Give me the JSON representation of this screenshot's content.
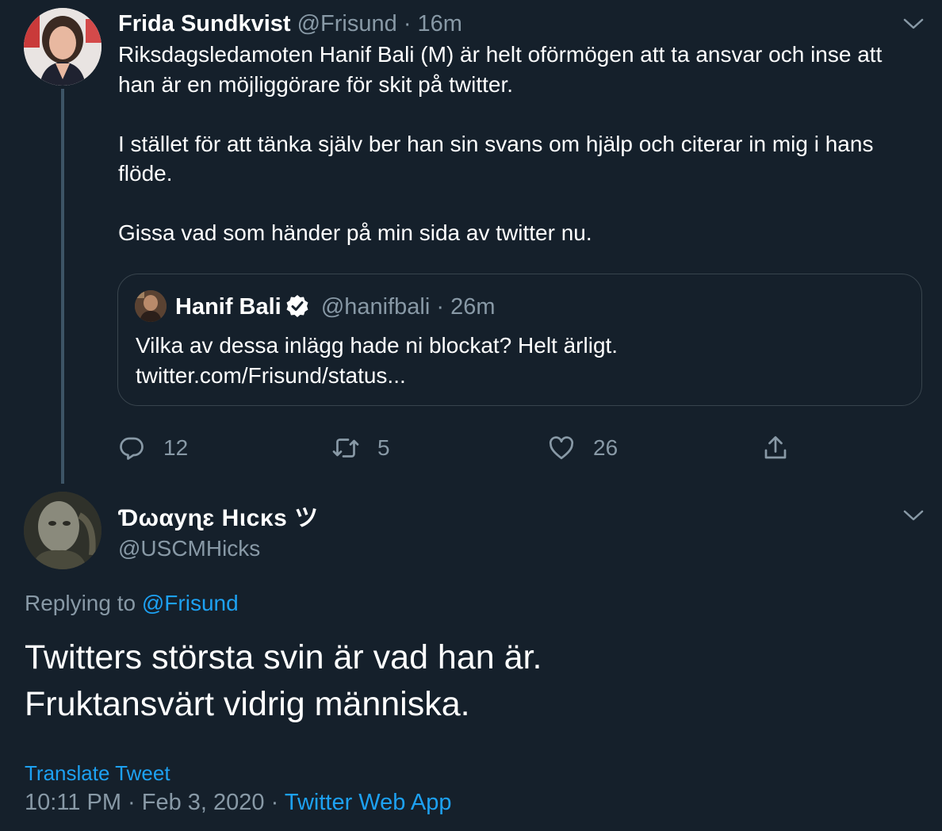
{
  "parent_tweet": {
    "author_name": "Frida Sundkvist",
    "handle": "@Frisund",
    "separator": "·",
    "time": "16m",
    "body": "Riksdagsledamoten Hanif Bali (M) är helt oförmögen att ta ansvar och inse att han är en möjliggörare för skit på twitter.\n\nI stället för att tänka själv ber han sin svans om hjälp och citerar in mig i hans flöde.\n\nGissa vad som händer på min sida av twitter nu.",
    "quoted": {
      "author_name": "Hanif Bali",
      "verified": true,
      "handle": "@hanifbali",
      "separator": "·",
      "time": "26m",
      "body": "Vilka av dessa inlägg hade ni blockat? Helt ärligt.\ntwitter.com/Frisund/status..."
    },
    "actions": {
      "reply_count": "12",
      "retweet_count": "5",
      "like_count": "26"
    }
  },
  "reply_tweet": {
    "author_name": "Ɗωαуɳɛ Ηιcκs ツ",
    "handle": "@USCMHicks",
    "replying_prefix": "Replying to",
    "replying_to": "@Frisund",
    "body": "Twitters största svin är vad han är.\nFruktansvärt vidrig människa.",
    "translate_label": "Translate Tweet",
    "timestamp": "10:11 PM · Feb 3, 2020",
    "separator": "·",
    "source": "Twitter Web App"
  },
  "icons": {
    "reply": "reply-icon",
    "retweet": "retweet-icon",
    "like": "heart-icon",
    "share": "share-icon",
    "more": "chevron-down-icon",
    "verified": "verified-badge-icon"
  },
  "colors": {
    "background": "#15202b",
    "text": "#ffffff",
    "muted": "#8899a6",
    "link": "#1da1f2",
    "border": "#38444d"
  }
}
